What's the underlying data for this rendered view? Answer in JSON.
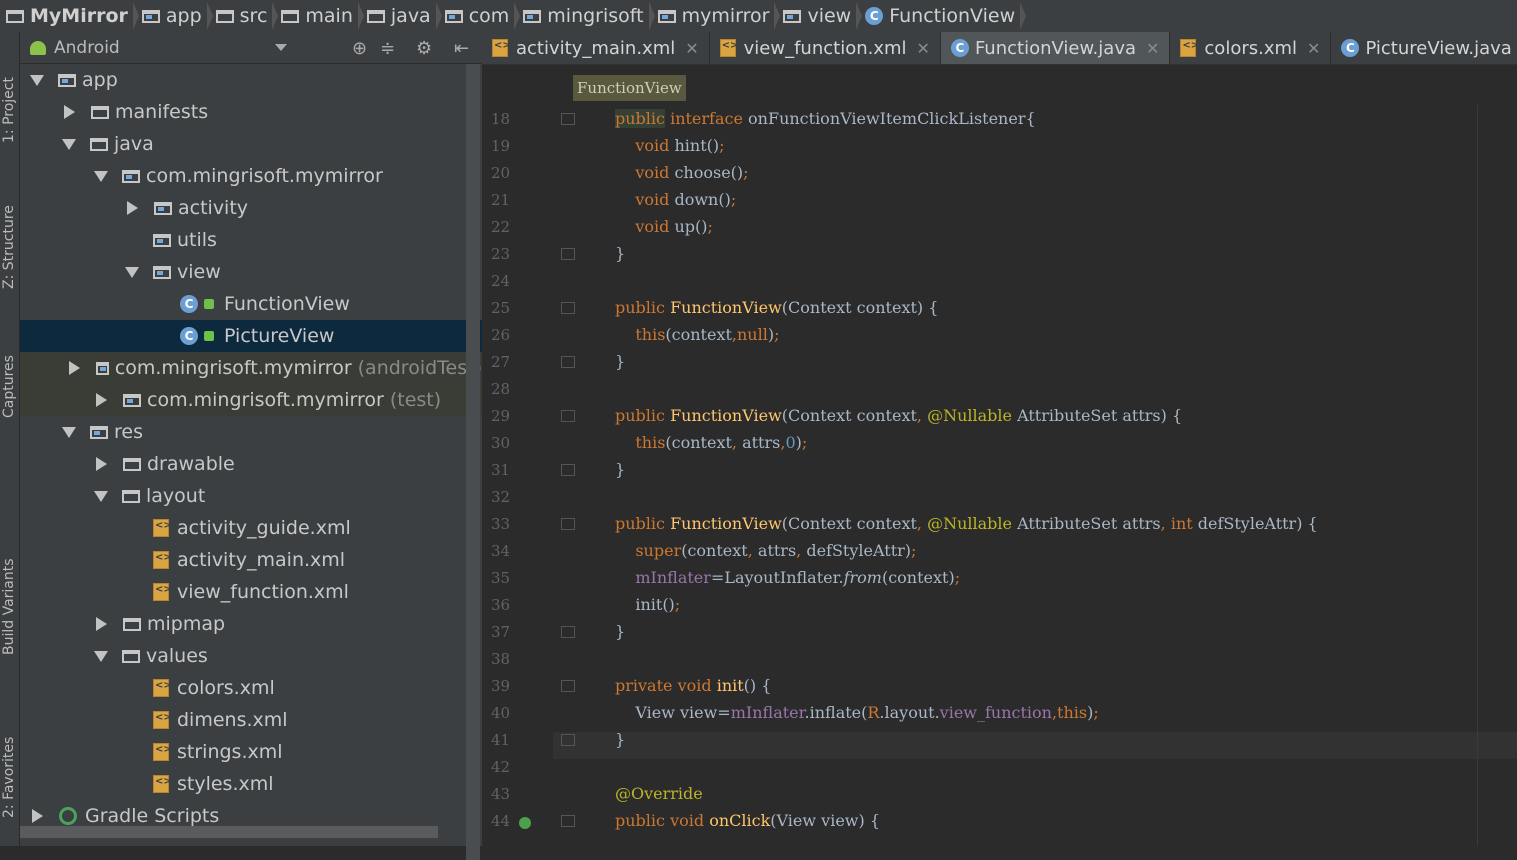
{
  "breadcrumb": [
    {
      "label": "MyMirror",
      "icon": "folder-icon"
    },
    {
      "label": "app",
      "icon": "module-folder-icon"
    },
    {
      "label": "src",
      "icon": "folder-icon"
    },
    {
      "label": "main",
      "icon": "folder-icon"
    },
    {
      "label": "java",
      "icon": "folder-icon"
    },
    {
      "label": "com",
      "icon": "package-icon"
    },
    {
      "label": "mingrisoft",
      "icon": "package-icon"
    },
    {
      "label": "mymirror",
      "icon": "package-icon"
    },
    {
      "label": "view",
      "icon": "package-icon"
    },
    {
      "label": "FunctionView",
      "icon": "class-icon"
    }
  ],
  "side_tabs": [
    "1: Project",
    "Z: Structure",
    "Captures",
    "Build Variants",
    "2: Favorites"
  ],
  "project_pane": {
    "view_mode": "Android",
    "tree": [
      {
        "label": "app",
        "state": "expanded",
        "icon": "module-folder-icon"
      },
      {
        "label": "manifests",
        "state": "collapsed",
        "icon": "folder-icon"
      },
      {
        "label": "java",
        "state": "expanded",
        "icon": "folder-icon"
      },
      {
        "label": "com.mingrisoft.mymirror",
        "state": "expanded",
        "icon": "package-icon"
      },
      {
        "label": "activity",
        "state": "collapsed",
        "icon": "package-icon"
      },
      {
        "label": "utils",
        "state": "leaf",
        "icon": "package-icon"
      },
      {
        "label": "view",
        "state": "expanded",
        "icon": "package-icon"
      },
      {
        "label": "FunctionView",
        "state": "leaf",
        "icon": "class-icon"
      },
      {
        "label": "PictureView",
        "state": "leaf",
        "icon": "class-icon",
        "selected": true
      },
      {
        "label": "com.mingrisoft.mymirror",
        "suffix": "(androidTest)",
        "state": "collapsed",
        "icon": "package-icon"
      },
      {
        "label": "com.mingrisoft.mymirror",
        "suffix": "(test)",
        "state": "collapsed",
        "icon": "package-icon"
      },
      {
        "label": "res",
        "state": "expanded",
        "icon": "res-folder-icon"
      },
      {
        "label": "drawable",
        "state": "collapsed",
        "icon": "folder-icon"
      },
      {
        "label": "layout",
        "state": "expanded",
        "icon": "folder-icon"
      },
      {
        "label": "activity_guide.xml",
        "state": "leaf",
        "icon": "xml-file-icon"
      },
      {
        "label": "activity_main.xml",
        "state": "leaf",
        "icon": "xml-file-icon"
      },
      {
        "label": "view_function.xml",
        "state": "leaf",
        "icon": "xml-file-icon"
      },
      {
        "label": "mipmap",
        "state": "collapsed",
        "icon": "folder-icon"
      },
      {
        "label": "values",
        "state": "expanded",
        "icon": "folder-icon"
      },
      {
        "label": "colors.xml",
        "state": "leaf",
        "icon": "xml-file-icon"
      },
      {
        "label": "dimens.xml",
        "state": "leaf",
        "icon": "xml-file-icon"
      },
      {
        "label": "strings.xml",
        "state": "leaf",
        "icon": "xml-file-icon"
      },
      {
        "label": "styles.xml",
        "state": "leaf",
        "icon": "xml-file-icon"
      },
      {
        "label": "Gradle Scripts",
        "state": "collapsed",
        "icon": "gradle-icon"
      }
    ]
  },
  "editor_tabs": [
    {
      "label": "activity_main.xml",
      "icon": "xml-file-icon",
      "active": false
    },
    {
      "label": "view_function.xml",
      "icon": "xml-file-icon",
      "active": false
    },
    {
      "label": "FunctionView.java",
      "icon": "class-icon",
      "active": true
    },
    {
      "label": "colors.xml",
      "icon": "xml-file-icon",
      "active": false
    },
    {
      "label": "PictureView.java",
      "icon": "class-icon",
      "active": false
    }
  ],
  "editor": {
    "context_label": "FunctionView",
    "lines": [
      {
        "n": "18",
        "html": "<span class='kwh'>public</span> <span class='kw'>interface</span> onFunctionViewItemClickListener{"
      },
      {
        "n": "19",
        "html": "    <span class='kw'>void</span> hint()<span class='kw'>;</span>"
      },
      {
        "n": "20",
        "html": "    <span class='kw'>void</span> choose()<span class='kw'>;</span>"
      },
      {
        "n": "21",
        "html": "    <span class='kw'>void</span> down()<span class='kw'>;</span>"
      },
      {
        "n": "22",
        "html": "    <span class='kw'>void</span> up()<span class='kw'>;</span>"
      },
      {
        "n": "23",
        "html": "}"
      },
      {
        "n": "24",
        "html": ""
      },
      {
        "n": "25",
        "html": "<span class='kw'>public</span> <span class='fn'>FunctionView</span>(Context context) {"
      },
      {
        "n": "26",
        "html": "    <span class='kw'>this</span>(context<span class='kw'>,</span><span class='kw'>null</span>)<span class='kw'>;</span>"
      },
      {
        "n": "27",
        "html": "}"
      },
      {
        "n": "28",
        "html": ""
      },
      {
        "n": "29",
        "html": "<span class='kw'>public</span> <span class='fn'>FunctionView</span>(Context context<span class='kw'>,</span> <span class='an'>@Nullable</span> AttributeSet attrs) {"
      },
      {
        "n": "30",
        "html": "    <span class='kw'>this</span>(context<span class='kw'>,</span> attrs<span class='kw'>,</span><span class='num'>0</span>)<span class='kw'>;</span>"
      },
      {
        "n": "31",
        "html": "}"
      },
      {
        "n": "32",
        "html": ""
      },
      {
        "n": "33",
        "html": "<span class='kw'>public</span> <span class='fn'>FunctionView</span>(Context context<span class='kw'>,</span> <span class='an'>@Nullable</span> AttributeSet attrs<span class='kw'>,</span> <span class='kw'>int</span> defStyleAttr) {"
      },
      {
        "n": "34",
        "html": "    <span class='kw'>super</span>(context<span class='kw'>,</span> attrs<span class='kw'>,</span> defStyleAttr)<span class='kw'>;</span>"
      },
      {
        "n": "35",
        "html": "    <span class='fld'>mInflater</span>=LayoutInflater.<i>from</i>(context)<span class='kw'>;</span>"
      },
      {
        "n": "36",
        "html": "    init()<span class='kw'>;</span>"
      },
      {
        "n": "37",
        "html": "}"
      },
      {
        "n": "38",
        "html": ""
      },
      {
        "n": "39",
        "html": "<span class='kw'>private</span> <span class='kw'>void</span> <span class='fn'>init</span>() {"
      },
      {
        "n": "40",
        "html": "    View view=<span class='fld'>mInflater</span>.inflate(<span class='kw'>R</span>.layout.<span class='fld'>view_function</span><span class='kw'>,</span><span class='kw'>this</span>)<span class='kw'>;</span>"
      },
      {
        "n": "41",
        "html": "}"
      },
      {
        "n": "42",
        "html": ""
      },
      {
        "n": "43",
        "html": "<span class='an'>@Override</span>"
      },
      {
        "n": "44",
        "html": "<span class='kw'>public</span> <span class='kw'>void</span> <span class='fn'>onClick</span>(View view) {"
      }
    ]
  },
  "colors": {
    "selection": "#0d293e",
    "keyword": "#cc7832",
    "method": "#ffc66d",
    "annotation": "#bbb529",
    "field": "#9876aa"
  }
}
